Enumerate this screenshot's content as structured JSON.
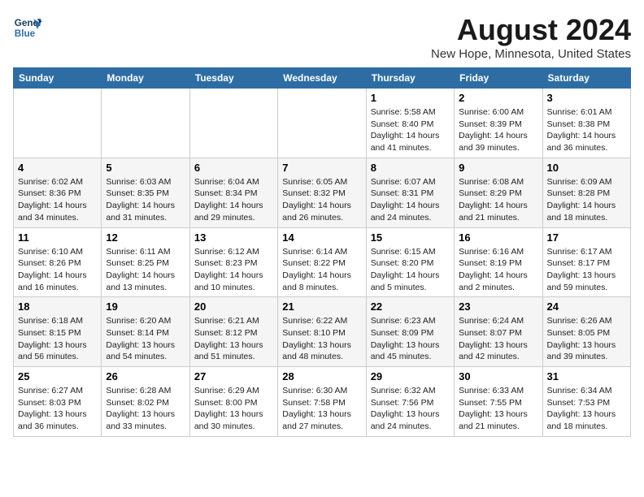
{
  "logo": {
    "line1": "General",
    "line2": "Blue"
  },
  "title": "August 2024",
  "subtitle": "New Hope, Minnesota, United States",
  "headers": [
    "Sunday",
    "Monday",
    "Tuesday",
    "Wednesday",
    "Thursday",
    "Friday",
    "Saturday"
  ],
  "weeks": [
    [
      {
        "day": "",
        "info": ""
      },
      {
        "day": "",
        "info": ""
      },
      {
        "day": "",
        "info": ""
      },
      {
        "day": "",
        "info": ""
      },
      {
        "day": "1",
        "info": "Sunrise: 5:58 AM\nSunset: 8:40 PM\nDaylight: 14 hours and 41 minutes."
      },
      {
        "day": "2",
        "info": "Sunrise: 6:00 AM\nSunset: 8:39 PM\nDaylight: 14 hours and 39 minutes."
      },
      {
        "day": "3",
        "info": "Sunrise: 6:01 AM\nSunset: 8:38 PM\nDaylight: 14 hours and 36 minutes."
      }
    ],
    [
      {
        "day": "4",
        "info": "Sunrise: 6:02 AM\nSunset: 8:36 PM\nDaylight: 14 hours and 34 minutes."
      },
      {
        "day": "5",
        "info": "Sunrise: 6:03 AM\nSunset: 8:35 PM\nDaylight: 14 hours and 31 minutes."
      },
      {
        "day": "6",
        "info": "Sunrise: 6:04 AM\nSunset: 8:34 PM\nDaylight: 14 hours and 29 minutes."
      },
      {
        "day": "7",
        "info": "Sunrise: 6:05 AM\nSunset: 8:32 PM\nDaylight: 14 hours and 26 minutes."
      },
      {
        "day": "8",
        "info": "Sunrise: 6:07 AM\nSunset: 8:31 PM\nDaylight: 14 hours and 24 minutes."
      },
      {
        "day": "9",
        "info": "Sunrise: 6:08 AM\nSunset: 8:29 PM\nDaylight: 14 hours and 21 minutes."
      },
      {
        "day": "10",
        "info": "Sunrise: 6:09 AM\nSunset: 8:28 PM\nDaylight: 14 hours and 18 minutes."
      }
    ],
    [
      {
        "day": "11",
        "info": "Sunrise: 6:10 AM\nSunset: 8:26 PM\nDaylight: 14 hours and 16 minutes."
      },
      {
        "day": "12",
        "info": "Sunrise: 6:11 AM\nSunset: 8:25 PM\nDaylight: 14 hours and 13 minutes."
      },
      {
        "day": "13",
        "info": "Sunrise: 6:12 AM\nSunset: 8:23 PM\nDaylight: 14 hours and 10 minutes."
      },
      {
        "day": "14",
        "info": "Sunrise: 6:14 AM\nSunset: 8:22 PM\nDaylight: 14 hours and 8 minutes."
      },
      {
        "day": "15",
        "info": "Sunrise: 6:15 AM\nSunset: 8:20 PM\nDaylight: 14 hours and 5 minutes."
      },
      {
        "day": "16",
        "info": "Sunrise: 6:16 AM\nSunset: 8:19 PM\nDaylight: 14 hours and 2 minutes."
      },
      {
        "day": "17",
        "info": "Sunrise: 6:17 AM\nSunset: 8:17 PM\nDaylight: 13 hours and 59 minutes."
      }
    ],
    [
      {
        "day": "18",
        "info": "Sunrise: 6:18 AM\nSunset: 8:15 PM\nDaylight: 13 hours and 56 minutes."
      },
      {
        "day": "19",
        "info": "Sunrise: 6:20 AM\nSunset: 8:14 PM\nDaylight: 13 hours and 54 minutes."
      },
      {
        "day": "20",
        "info": "Sunrise: 6:21 AM\nSunset: 8:12 PM\nDaylight: 13 hours and 51 minutes."
      },
      {
        "day": "21",
        "info": "Sunrise: 6:22 AM\nSunset: 8:10 PM\nDaylight: 13 hours and 48 minutes."
      },
      {
        "day": "22",
        "info": "Sunrise: 6:23 AM\nSunset: 8:09 PM\nDaylight: 13 hours and 45 minutes."
      },
      {
        "day": "23",
        "info": "Sunrise: 6:24 AM\nSunset: 8:07 PM\nDaylight: 13 hours and 42 minutes."
      },
      {
        "day": "24",
        "info": "Sunrise: 6:26 AM\nSunset: 8:05 PM\nDaylight: 13 hours and 39 minutes."
      }
    ],
    [
      {
        "day": "25",
        "info": "Sunrise: 6:27 AM\nSunset: 8:03 PM\nDaylight: 13 hours and 36 minutes."
      },
      {
        "day": "26",
        "info": "Sunrise: 6:28 AM\nSunset: 8:02 PM\nDaylight: 13 hours and 33 minutes."
      },
      {
        "day": "27",
        "info": "Sunrise: 6:29 AM\nSunset: 8:00 PM\nDaylight: 13 hours and 30 minutes."
      },
      {
        "day": "28",
        "info": "Sunrise: 6:30 AM\nSunset: 7:58 PM\nDaylight: 13 hours and 27 minutes."
      },
      {
        "day": "29",
        "info": "Sunrise: 6:32 AM\nSunset: 7:56 PM\nDaylight: 13 hours and 24 minutes."
      },
      {
        "day": "30",
        "info": "Sunrise: 6:33 AM\nSunset: 7:55 PM\nDaylight: 13 hours and 21 minutes."
      },
      {
        "day": "31",
        "info": "Sunrise: 6:34 AM\nSunset: 7:53 PM\nDaylight: 13 hours and 18 minutes."
      }
    ]
  ]
}
